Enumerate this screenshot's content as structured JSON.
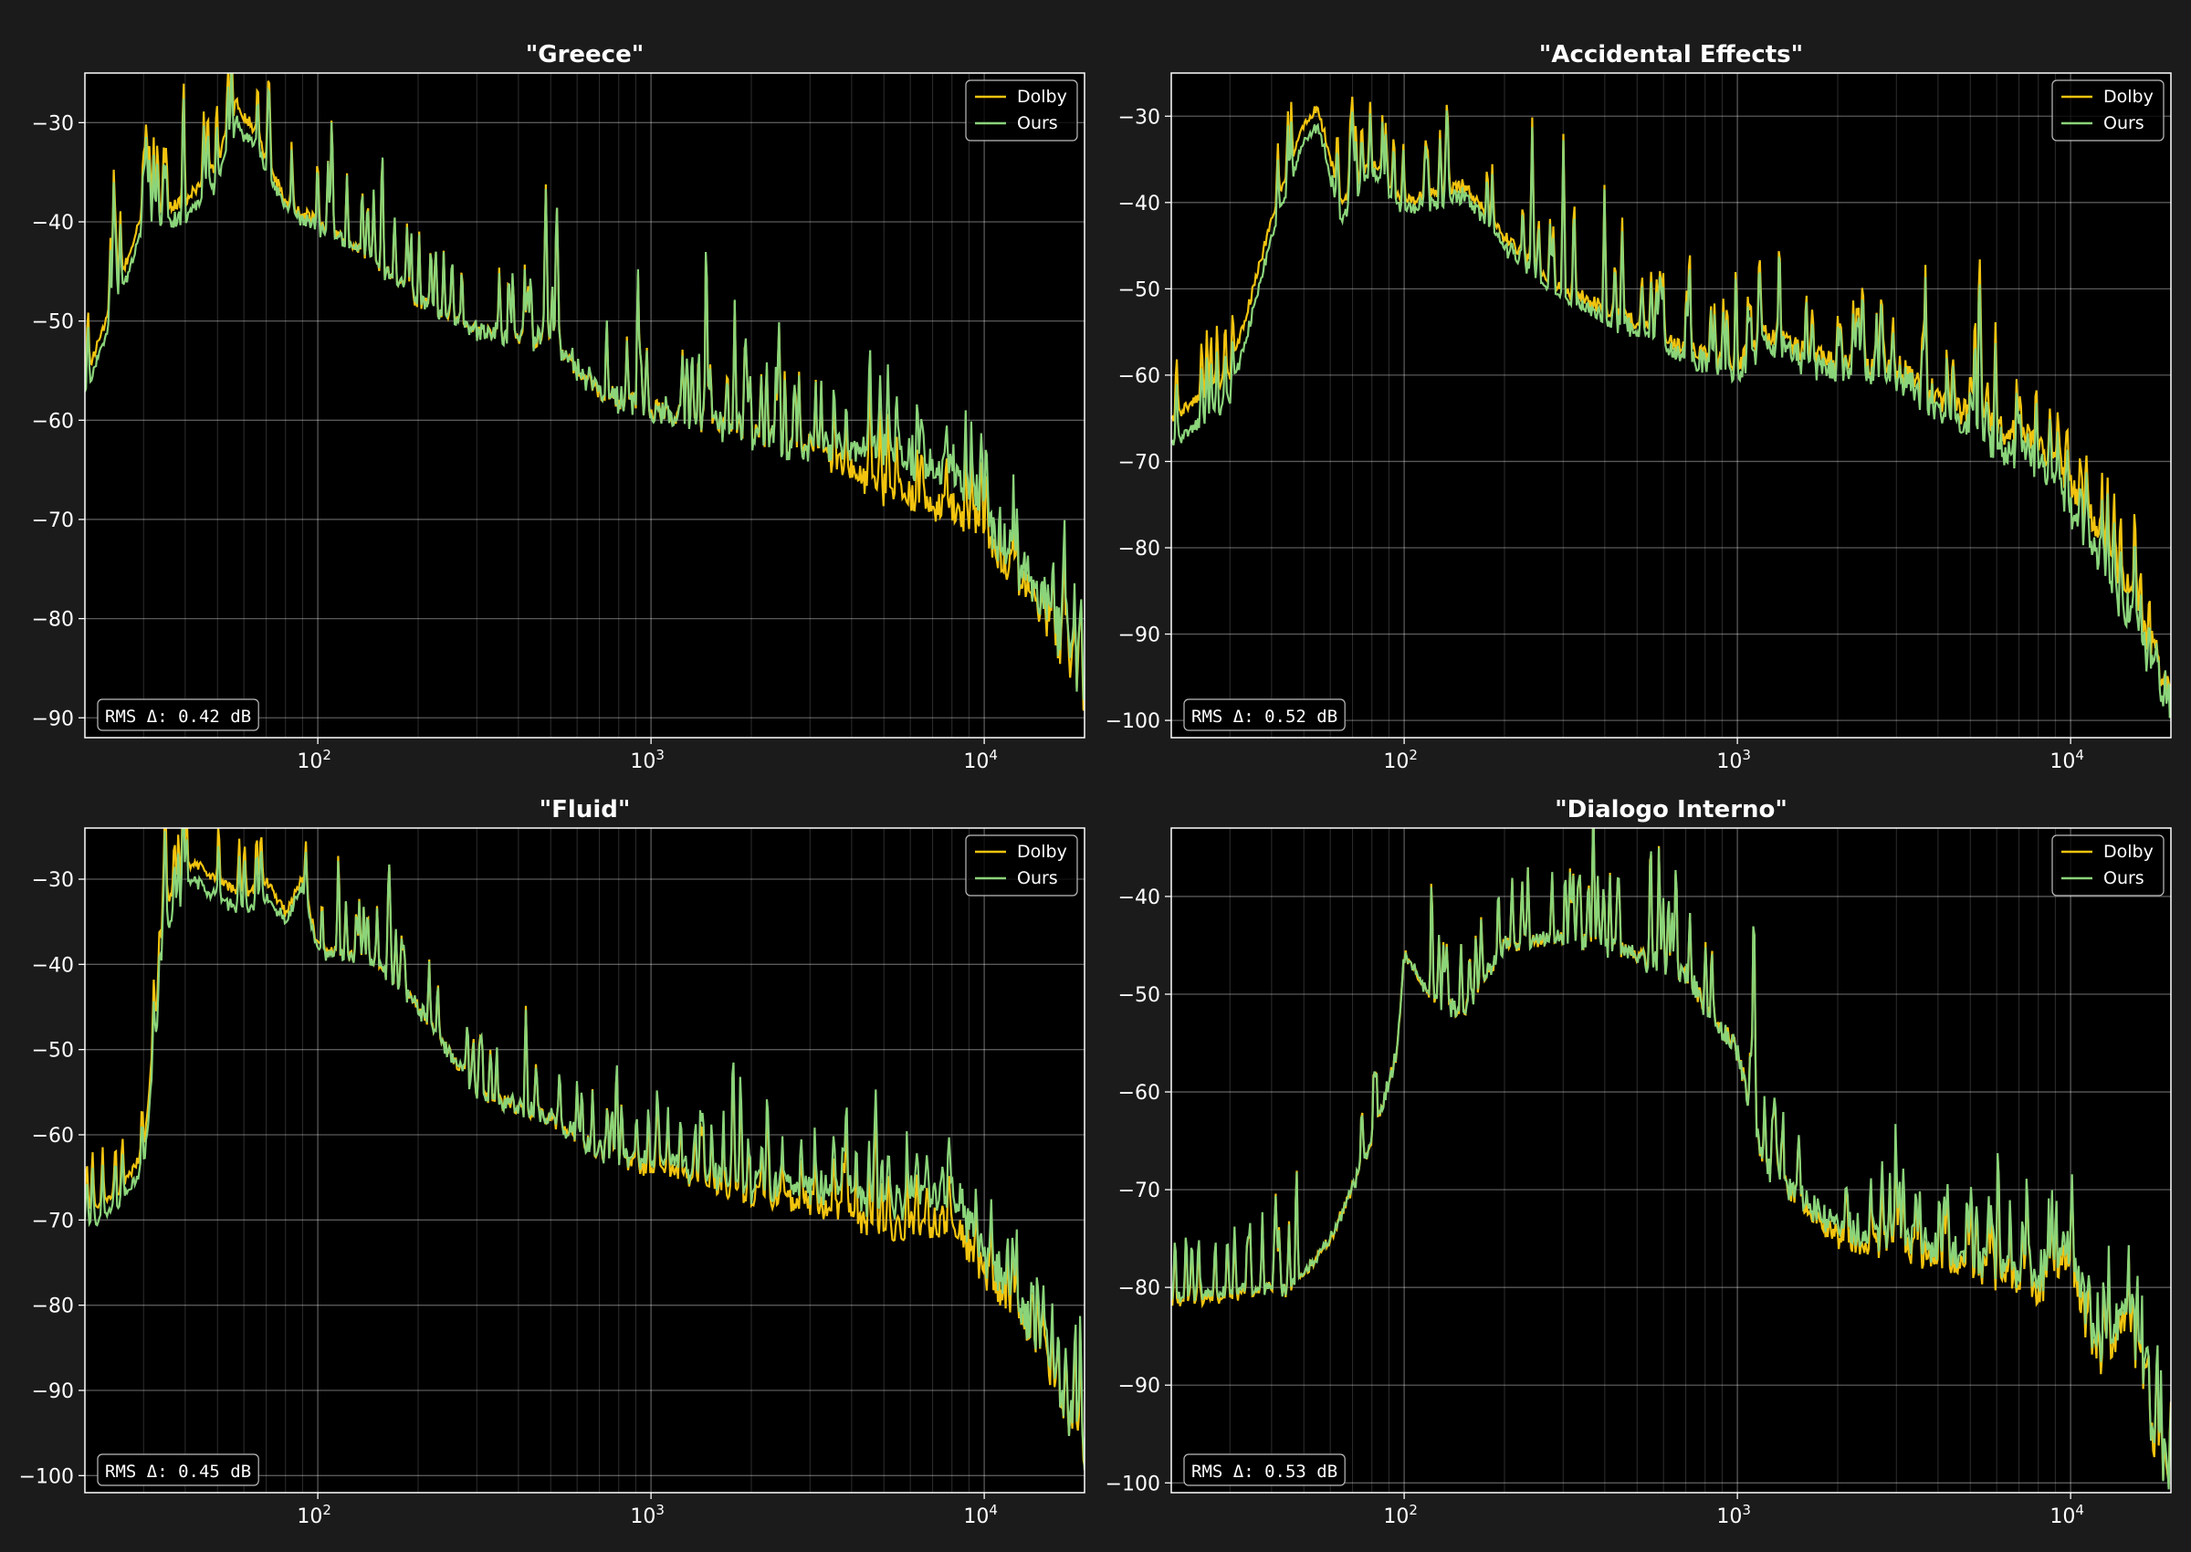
{
  "figure": {
    "background": "#1b1b1b",
    "plot_background": "#000000"
  },
  "legend": {
    "entries": [
      {
        "label": "Dolby",
        "color": "#f2c40f"
      },
      {
        "label": "Ours",
        "color": "#8bd47a"
      }
    ]
  },
  "chart_data": [
    {
      "type": "line",
      "title": "\"Greece\"",
      "xscale": "log",
      "xlim": [
        20,
        20000
      ],
      "ylim": [
        -92,
        -25
      ],
      "yticks": [
        -30,
        -40,
        -50,
        -60,
        -70,
        -80,
        -90
      ],
      "xticks": [
        100,
        1000,
        10000
      ],
      "xtick_labels": [
        {
          "base": "10",
          "exp": "2"
        },
        {
          "base": "10",
          "exp": "3"
        },
        {
          "base": "10",
          "exp": "4"
        }
      ],
      "grid": true,
      "legend_position": "top-right",
      "annotation": "RMS Δ: 0.42 dB",
      "series": [
        {
          "name": "Dolby",
          "color": "#f2c40f",
          "x": [
            20,
            30,
            40,
            50,
            57,
            65,
            80,
            100,
            150,
            200,
            300,
            500,
            700,
            1000,
            2000,
            3000,
            5000,
            8000,
            10000,
            15000,
            20000
          ],
          "y": [
            -56,
            -39,
            -38,
            -34,
            -28,
            -31,
            -38,
            -40,
            -44,
            -48,
            -51,
            -52,
            -57,
            -59,
            -61,
            -63,
            -67,
            -69,
            -71,
            -79,
            -88
          ]
        },
        {
          "name": "Ours",
          "color": "#8bd47a",
          "x": [
            20,
            30,
            40,
            50,
            57,
            65,
            80,
            100,
            150,
            200,
            300,
            500,
            700,
            1000,
            2000,
            3000,
            5000,
            8000,
            10000,
            15000,
            20000
          ],
          "y": [
            -57.5,
            -40.5,
            -39.5,
            -36,
            -30,
            -32.5,
            -38.5,
            -40.5,
            -44,
            -48,
            -51,
            -52,
            -57,
            -59,
            -61,
            -63,
            -63,
            -65,
            -69,
            -78,
            -87
          ]
        }
      ]
    },
    {
      "type": "line",
      "title": "\"Accidental Effects\"",
      "xscale": "log",
      "xlim": [
        20,
        20000
      ],
      "ylim": [
        -102,
        -25
      ],
      "yticks": [
        -30,
        -40,
        -50,
        -60,
        -70,
        -80,
        -90,
        -100
      ],
      "xticks": [
        100,
        1000,
        10000
      ],
      "xtick_labels": [
        {
          "base": "10",
          "exp": "2"
        },
        {
          "base": "10",
          "exp": "3"
        },
        {
          "base": "10",
          "exp": "4"
        }
      ],
      "grid": true,
      "legend_position": "top-right",
      "annotation": "RMS Δ: 0.52 dB",
      "series": [
        {
          "name": "Dolby",
          "color": "#f2c40f",
          "x": [
            20,
            30,
            40,
            50,
            55,
            65,
            80,
            100,
            150,
            200,
            300,
            500,
            700,
            1000,
            1200,
            2000,
            3000,
            5000,
            8000,
            10000,
            15000,
            20000
          ],
          "y": [
            -65,
            -60,
            -42,
            -31,
            -29,
            -40,
            -35,
            -40,
            -38,
            -44,
            -50,
            -54,
            -57,
            -59,
            -55,
            -59,
            -59,
            -65,
            -68,
            -72,
            -85,
            -97
          ]
        },
        {
          "name": "Ours",
          "color": "#8bd47a",
          "x": [
            20,
            30,
            40,
            50,
            55,
            65,
            80,
            100,
            150,
            200,
            300,
            500,
            700,
            1000,
            1200,
            2000,
            3000,
            5000,
            8000,
            10000,
            15000,
            20000
          ],
          "y": [
            -68,
            -63,
            -44,
            -33,
            -31,
            -42,
            -36,
            -41,
            -39,
            -45,
            -51,
            -55,
            -58,
            -60,
            -56,
            -60,
            -60,
            -67,
            -70,
            -75,
            -88,
            -98
          ]
        }
      ]
    },
    {
      "type": "line",
      "title": "\"Fluid\"",
      "xscale": "log",
      "xlim": [
        20,
        20000
      ],
      "ylim": [
        -102,
        -24
      ],
      "yticks": [
        -30,
        -40,
        -50,
        -60,
        -70,
        -80,
        -90,
        -100
      ],
      "xticks": [
        100,
        1000,
        10000
      ],
      "xtick_labels": [
        {
          "base": "10",
          "exp": "2"
        },
        {
          "base": "10",
          "exp": "3"
        },
        {
          "base": "10",
          "exp": "4"
        }
      ],
      "grid": true,
      "legend_position": "top-right",
      "annotation": "RMS Δ: 0.45 dB",
      "series": [
        {
          "name": "Dolby",
          "color": "#f2c40f",
          "x": [
            20,
            25,
            30,
            35,
            42,
            50,
            60,
            70,
            80,
            90,
            100,
            150,
            200,
            300,
            500,
            700,
            1000,
            2000,
            3000,
            5000,
            8000,
            10000,
            15000,
            20000
          ],
          "y": [
            -69,
            -67,
            -62,
            -33,
            -28,
            -30,
            -32,
            -30,
            -34,
            -30,
            -38,
            -40,
            -45,
            -55,
            -58,
            -62,
            -64,
            -67,
            -68,
            -71,
            -70,
            -76,
            -85,
            -98
          ]
        },
        {
          "name": "Ours",
          "color": "#8bd47a",
          "x": [
            20,
            25,
            30,
            35,
            42,
            50,
            60,
            70,
            80,
            90,
            100,
            150,
            200,
            300,
            500,
            700,
            1000,
            2000,
            3000,
            5000,
            8000,
            10000,
            15000,
            20000
          ],
          "y": [
            -71,
            -68.5,
            -64,
            -36,
            -30,
            -32,
            -34,
            -32,
            -35,
            -31,
            -38.5,
            -40,
            -45,
            -55,
            -58,
            -62,
            -63,
            -66,
            -66,
            -68,
            -66,
            -74,
            -84,
            -97
          ]
        }
      ]
    },
    {
      "type": "line",
      "title": "\"Dialogo Interno\"",
      "xscale": "log",
      "xlim": [
        20,
        20000
      ],
      "ylim": [
        -101,
        -33
      ],
      "yticks": [
        -40,
        -50,
        -60,
        -70,
        -80,
        -90,
        -100
      ],
      "xticks": [
        100,
        1000,
        10000
      ],
      "xtick_labels": [
        {
          "base": "10",
          "exp": "2"
        },
        {
          "base": "10",
          "exp": "3"
        },
        {
          "base": "10",
          "exp": "4"
        }
      ],
      "grid": true,
      "legend_position": "top-right",
      "annotation": "RMS Δ: 0.53 dB",
      "series": [
        {
          "name": "Dolby",
          "color": "#f2c40f",
          "x": [
            20,
            30,
            40,
            45,
            60,
            80,
            95,
            100,
            120,
            150,
            200,
            300,
            500,
            700,
            1000,
            1200,
            2000,
            3000,
            5000,
            8000,
            10000,
            12000,
            15000,
            18000,
            20000
          ],
          "y": [
            -81.5,
            -81,
            -80,
            -80.5,
            -75,
            -65,
            -56,
            -46,
            -50,
            -52,
            -45,
            -44,
            -46,
            -48,
            -56,
            -67,
            -75,
            -76,
            -78,
            -80,
            -77,
            -88,
            -83,
            -97,
            -99
          ]
        },
        {
          "name": "Ours",
          "color": "#8bd47a",
          "x": [
            20,
            30,
            40,
            45,
            60,
            80,
            95,
            100,
            120,
            150,
            200,
            300,
            500,
            700,
            1000,
            1200,
            2000,
            3000,
            5000,
            8000,
            10000,
            12000,
            15000,
            18000,
            20000
          ],
          "y": [
            -81,
            -80.5,
            -80,
            -80.5,
            -75,
            -65,
            -56,
            -46,
            -50,
            -52,
            -45,
            -44,
            -46,
            -48,
            -56,
            -67,
            -74,
            -75,
            -77,
            -79,
            -76,
            -87,
            -82,
            -96,
            -99
          ]
        }
      ]
    }
  ]
}
